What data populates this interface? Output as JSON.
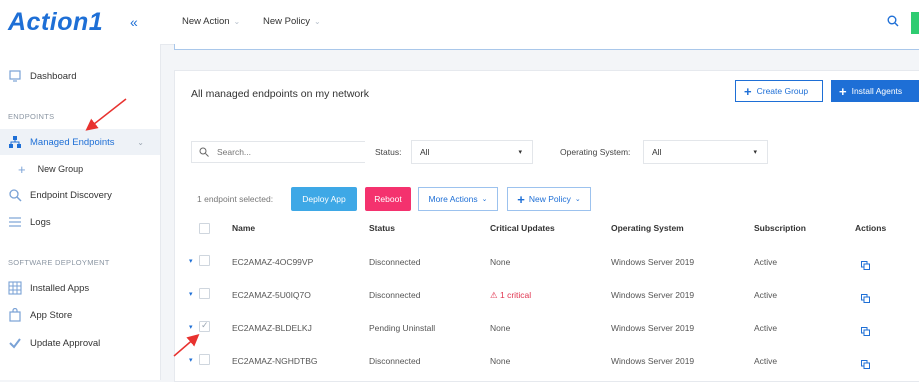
{
  "brand": {
    "logo_text": "Action1",
    "collapse_glyph": "«"
  },
  "colors": {
    "accent": "#1e6fd6",
    "deploy": "#3ea8e6",
    "reboot": "#f4326e",
    "critical": "#e0344f",
    "annotation_arrow": "#e8322f"
  },
  "topbar": {
    "new_action": "New Action",
    "new_policy": "New Policy",
    "search_icon": "search-icon"
  },
  "sidebar": {
    "dashboard": "Dashboard",
    "section_endpoints": "ENDPOINTS",
    "managed_endpoints": "Managed Endpoints",
    "new_group": "New Group",
    "endpoint_discovery": "Endpoint Discovery",
    "logs": "Logs",
    "section_software": "SOFTWARE DEPLOYMENT",
    "installed_apps": "Installed Apps",
    "app_store": "App Store",
    "update_approval": "Update Approval"
  },
  "main": {
    "title": "All managed endpoints on my network",
    "create_group": "Create Group",
    "install_agents": "Install Agents",
    "search_placeholder": "Search...",
    "status_label": "Status:",
    "status_value": "All",
    "os_label": "Operating System:",
    "os_value": "All",
    "selected_info": "1 endpoint selected:",
    "deploy_app": "Deploy App",
    "reboot": "Reboot",
    "more_actions": "More Actions",
    "new_policy": "New Policy",
    "columns": {
      "name": "Name",
      "status": "Status",
      "critical": "Critical Updates",
      "os": "Operating System",
      "subscription": "Subscription",
      "actions": "Actions"
    },
    "rows": [
      {
        "name": "EC2AMAZ-4OC99VP",
        "status": "Disconnected",
        "critical": "None",
        "os": "Windows Server 2019",
        "subscription": "Active",
        "checked": false
      },
      {
        "name": "EC2AMAZ-5U0IQ7O",
        "status": "Disconnected",
        "critical": "1 critical",
        "os": "Windows Server 2019",
        "subscription": "Active",
        "checked": false
      },
      {
        "name": "EC2AMAZ-BLDELKJ",
        "status": "Pending Uninstall",
        "critical": "None",
        "os": "Windows Server 2019",
        "subscription": "Active",
        "checked": true
      },
      {
        "name": "EC2AMAZ-NGHDTBG",
        "status": "Disconnected",
        "critical": "None",
        "os": "Windows Server 2019",
        "subscription": "Active",
        "checked": false
      }
    ]
  }
}
